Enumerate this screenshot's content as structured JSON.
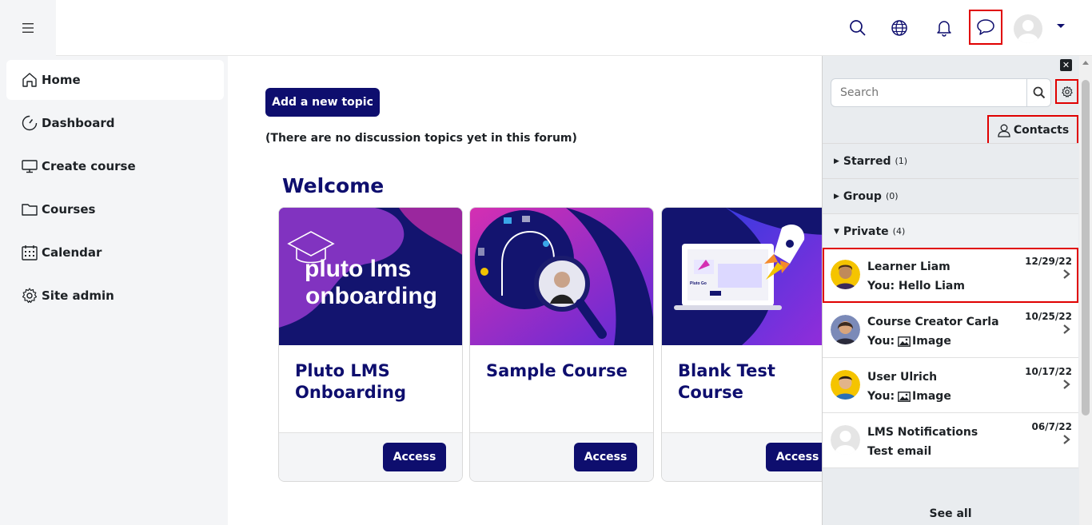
{
  "header": {
    "menu_icon": "hamburger-icon",
    "icons": [
      "search-icon",
      "globe-icon",
      "bell-icon",
      "chat-icon",
      "avatar",
      "caret-down-icon"
    ]
  },
  "sidebar": {
    "items": [
      {
        "label": "Home",
        "icon": "home-icon",
        "active": true
      },
      {
        "label": "Dashboard",
        "icon": "gauge-icon"
      },
      {
        "label": "Create course",
        "icon": "monitor-icon"
      },
      {
        "label": "Courses",
        "icon": "folder-icon"
      },
      {
        "label": "Calendar",
        "icon": "calendar-icon"
      },
      {
        "label": "Site admin",
        "icon": "gear-icon"
      }
    ]
  },
  "main": {
    "add_topic_label": "Add a new topic",
    "no_topics_text": "(There are no discussion topics yet in this forum)",
    "welcome_title": "Welcome",
    "cards": [
      {
        "title": "Pluto LMS Onboarding",
        "image_text_line1": "pluto lms",
        "image_text_line2": "onboarding",
        "access_label": "Access"
      },
      {
        "title": "Sample Course",
        "access_label": "Access"
      },
      {
        "title": "Blank Test Course",
        "image_text": "Pluto Go",
        "access_label": "Access"
      }
    ]
  },
  "drawer": {
    "close_label": "✕",
    "search_placeholder": "Search",
    "contacts_label": "Contacts",
    "sections": [
      {
        "label": "Starred",
        "count": "(1)",
        "expanded": false
      },
      {
        "label": "Group",
        "count": "(0)",
        "expanded": false
      },
      {
        "label": "Private",
        "count": "(4)",
        "expanded": true
      }
    ],
    "messages": [
      {
        "name": "Learner Liam",
        "preview": "You: Hello Liam",
        "date": "12/29/22",
        "has_image": false,
        "highlighted": true
      },
      {
        "name": "Course Creator Carla",
        "preview": "You:",
        "preview_suffix": "Image",
        "date": "10/25/22",
        "has_image": true
      },
      {
        "name": "User Ulrich",
        "preview": "You:",
        "preview_suffix": "Image",
        "date": "10/17/22",
        "has_image": true
      },
      {
        "name": "LMS Notifications",
        "preview": "Test email",
        "date": "06/7/22",
        "has_image": false
      }
    ],
    "see_all_label": "See all"
  },
  "colors": {
    "brand_navy": "#0e0e6e",
    "highlight_red": "#e00000",
    "drawer_bg": "#e9ecef"
  }
}
